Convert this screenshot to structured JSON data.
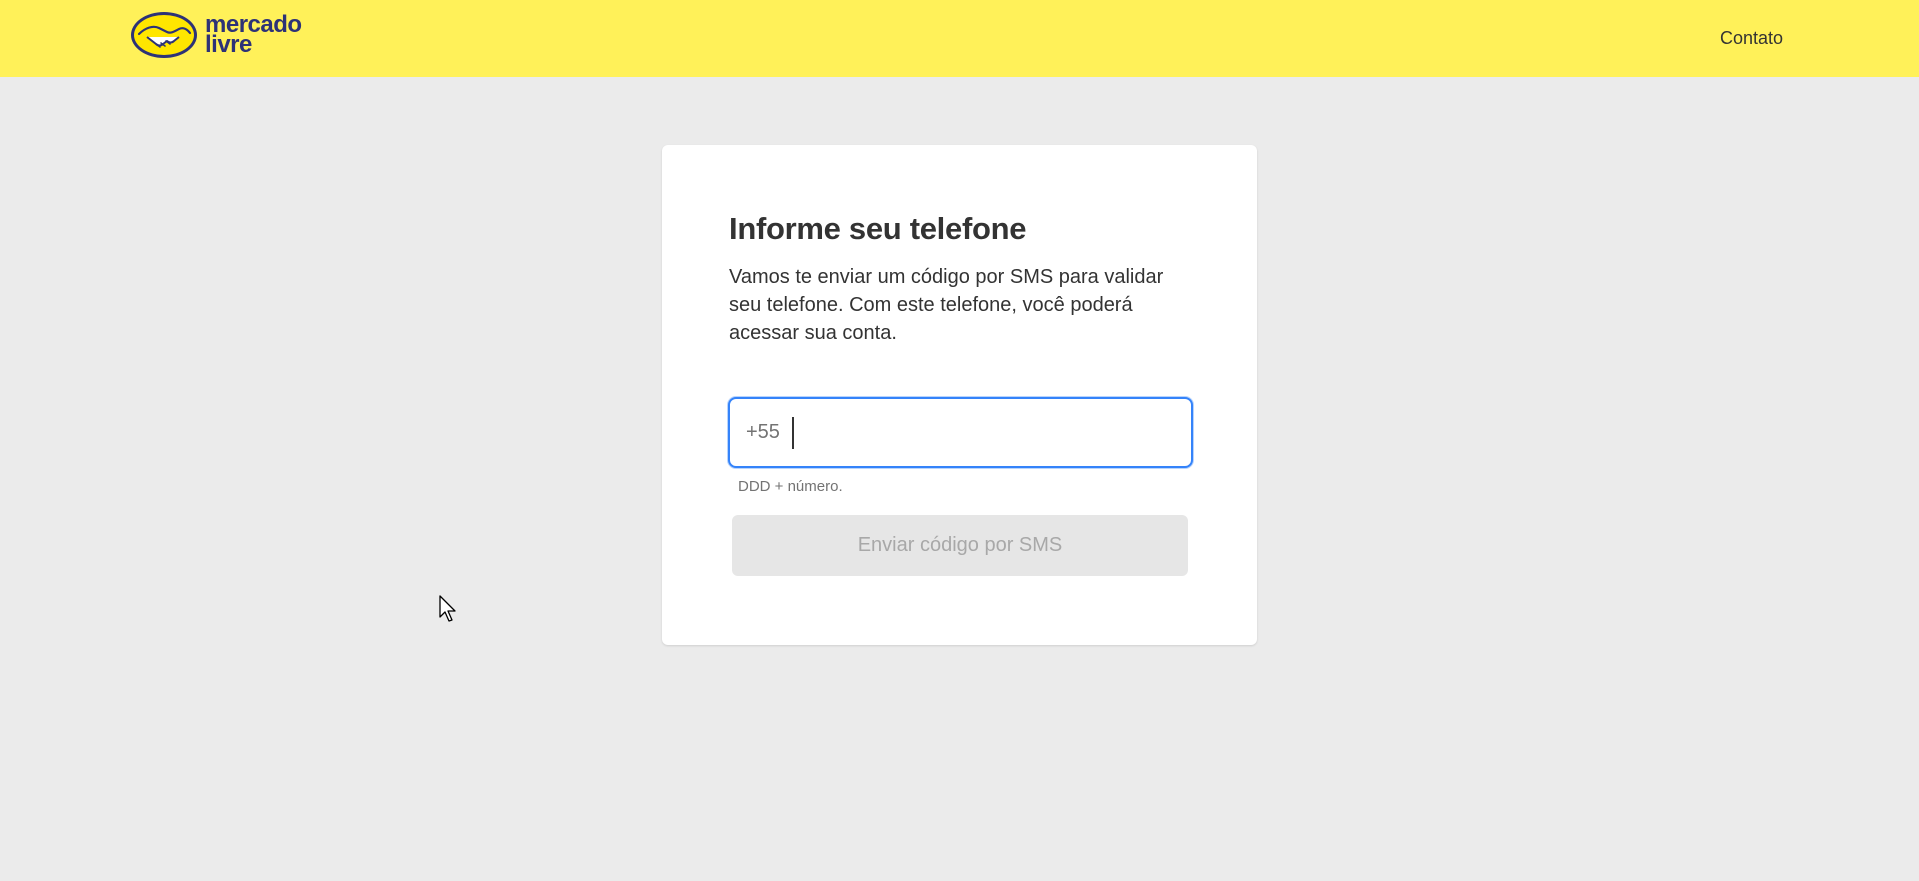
{
  "header": {
    "logo_line1": "mercado",
    "logo_line2": "livre",
    "contact_label": "Contato",
    "background_color": "#fff159",
    "logo_text_color": "#2d3277"
  },
  "card": {
    "title": "Informe seu telefone",
    "description": "Vamos te enviar um código por SMS para validar seu telefone. Com este telefone, você poderá acessar sua conta.",
    "phone": {
      "prefix": "+55",
      "value": "",
      "helper": "DDD + número."
    },
    "submit_label": "Enviar código por SMS",
    "submit_disabled": true
  },
  "colors": {
    "page_background": "#ebebeb",
    "focus_border": "#3483fa",
    "disabled_button_bg": "#e6e6e6",
    "disabled_button_text": "#a8a8a8"
  },
  "icons": {
    "logo": "handshake-icon",
    "pointer": "mouse-pointer-icon"
  }
}
